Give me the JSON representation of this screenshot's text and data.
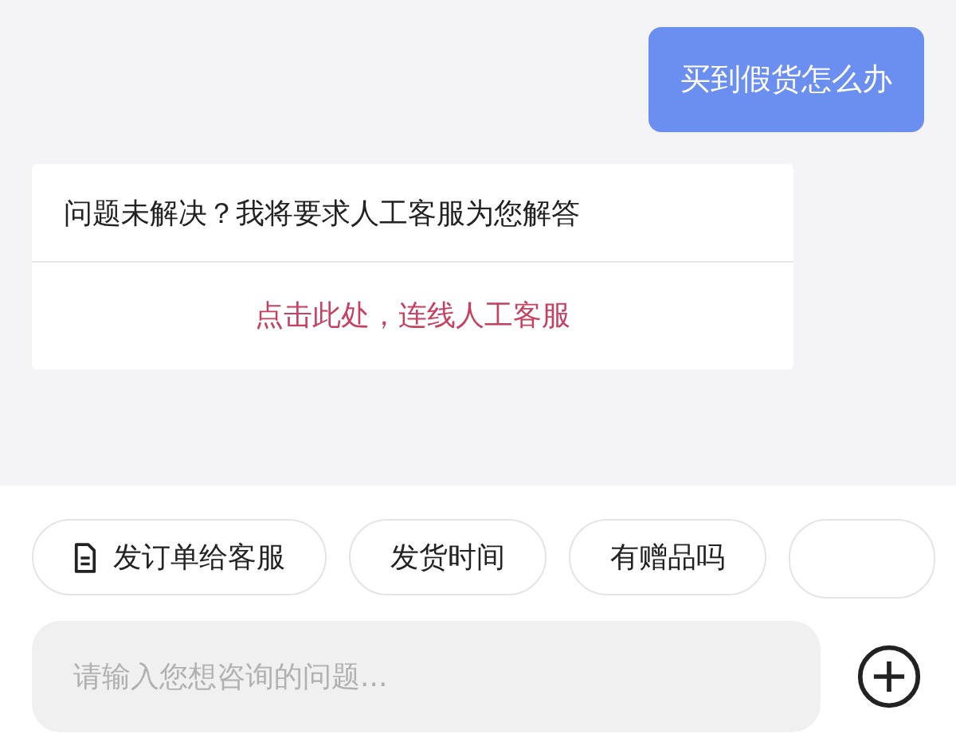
{
  "messages": [
    {
      "kind": "user",
      "text": "买到假货怎么办"
    },
    {
      "kind": "bot",
      "text": "问题未解决？我将要求人工客服为您解答",
      "link": "点击此处，连线人工客服"
    }
  ],
  "quick_replies": [
    {
      "kind": "order",
      "label": "发订单给客服"
    },
    {
      "kind": "text",
      "label": "发货时间"
    },
    {
      "kind": "text",
      "label": "有赠品吗"
    },
    {
      "kind": "cut"
    }
  ],
  "input": {
    "placeholder": "请输入您想咨询的问题..."
  }
}
